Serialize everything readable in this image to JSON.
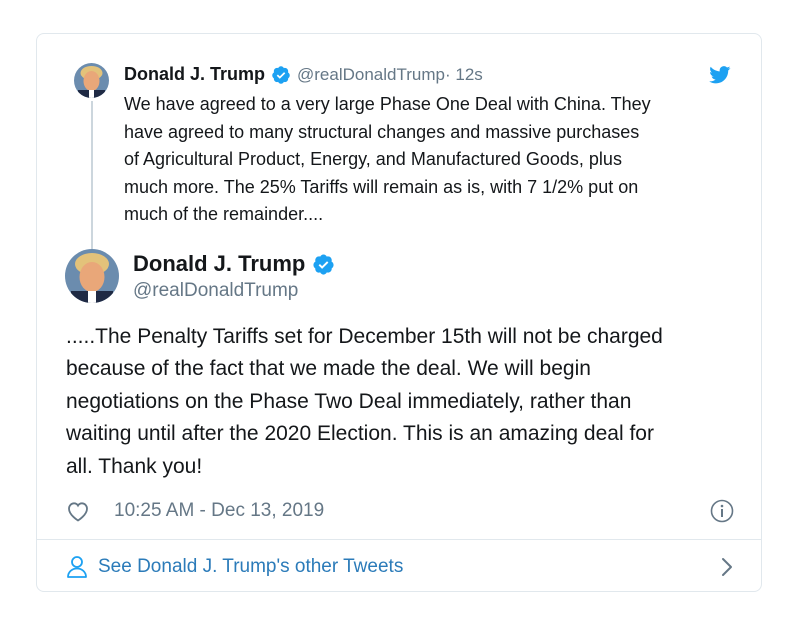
{
  "colors": {
    "accent": "#1da1f2",
    "link": "#2b7bb9",
    "secondary_text": "#657786",
    "border": "#e1e8ed"
  },
  "parent_tweet": {
    "author_name": "Donald J. Trump",
    "handle": "@realDonaldTrump",
    "time": " · 12s",
    "text": "We have agreed to a very large Phase One Deal with China. They\nhave agreed to many structural changes and massive purchases\nof Agricultural Product, Energy, and Manufactured Goods, plus\nmuch more. The 25% Tariffs will remain as is, with 7 1/2% put on\nmuch of the remainder....",
    "icons": [
      "avatar",
      "verified-badge-icon",
      "twitter-bird-icon"
    ]
  },
  "main_tweet": {
    "author_name": "Donald J. Trump",
    "handle": "@realDonaldTrump",
    "text": ".....The Penalty Tariffs set for December 15th will not be charged\nbecause of the fact that we made the deal. We will begin\nnegotiations on the Phase Two Deal immediately, rather than\nwaiting until after the 2020 Election. This is an amazing deal for\nall. Thank you!",
    "timestamp": "10:25 AM - Dec 13, 2019",
    "icons": [
      "heart-icon",
      "info-icon"
    ]
  },
  "footer": {
    "link_label": "See Donald J. Trump's other Tweets",
    "icons": [
      "person-icon",
      "chevron-right-icon"
    ]
  }
}
